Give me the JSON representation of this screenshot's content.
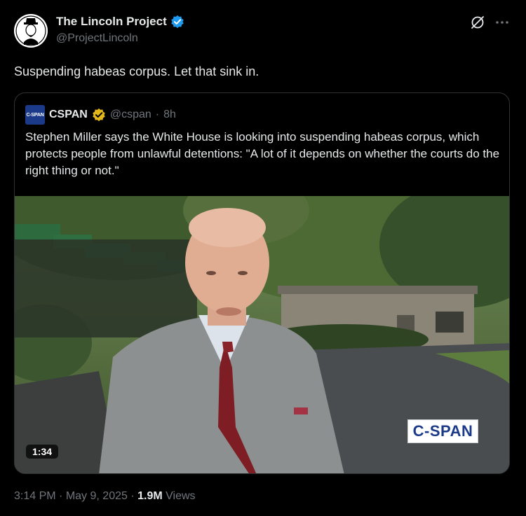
{
  "author": {
    "name": "The Lincoln Project",
    "handle": "@ProjectLincoln",
    "verified_color": "#1d9bf0"
  },
  "header_icons": [
    "grok-icon",
    "more-icon"
  ],
  "post": {
    "text": "Suspending habeas corpus. Let that sink in."
  },
  "quote": {
    "avatar_text": "C-SPAN",
    "name": "CSPAN",
    "handle": "@cspan",
    "separator": "·",
    "time": "8h",
    "badge_color": "#e2b719",
    "text": "Stephen Miller says the White House is looking into suspending habeas corpus, which protects people from unlawful detentions: \"A lot of it depends on whether the courts do the right thing or not.\"",
    "video": {
      "duration": "1:34",
      "watermark": "C-SPAN"
    }
  },
  "footer": {
    "time": "3:14 PM",
    "sep1": "·",
    "date": "May 9, 2025",
    "sep2": "·",
    "views": "1.9M",
    "views_label": "Views"
  }
}
